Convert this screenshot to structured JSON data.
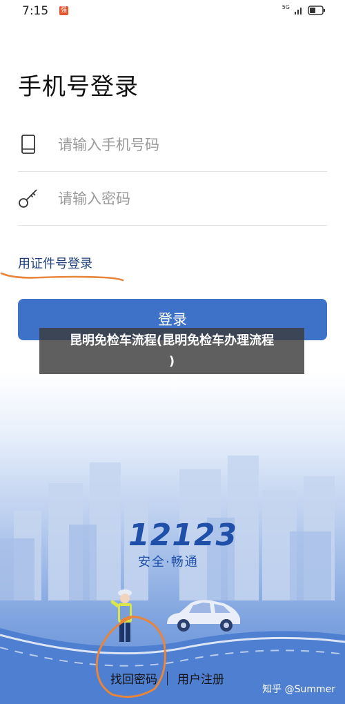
{
  "status_bar": {
    "time": "7:15",
    "network": "5G",
    "notification_badge": "强"
  },
  "page": {
    "title": "手机号登录"
  },
  "form": {
    "phone_placeholder": "请输入手机号码",
    "password_placeholder": "请输入密码",
    "id_login_label": "用证件号登录",
    "login_button": "登录"
  },
  "overlay": {
    "line1": "昆明免检车流程(昆明免检车办理流程",
    "line2": ")"
  },
  "brand": {
    "number": "12123",
    "slogan": "安全·畅通"
  },
  "footer": {
    "forgot_password": "找回密码",
    "register": "用户注册",
    "watermark": "知乎 @Summer"
  },
  "colors": {
    "primary": "#3d72c8",
    "annotation": "#e8853a",
    "brand": "#1f4fa8"
  }
}
